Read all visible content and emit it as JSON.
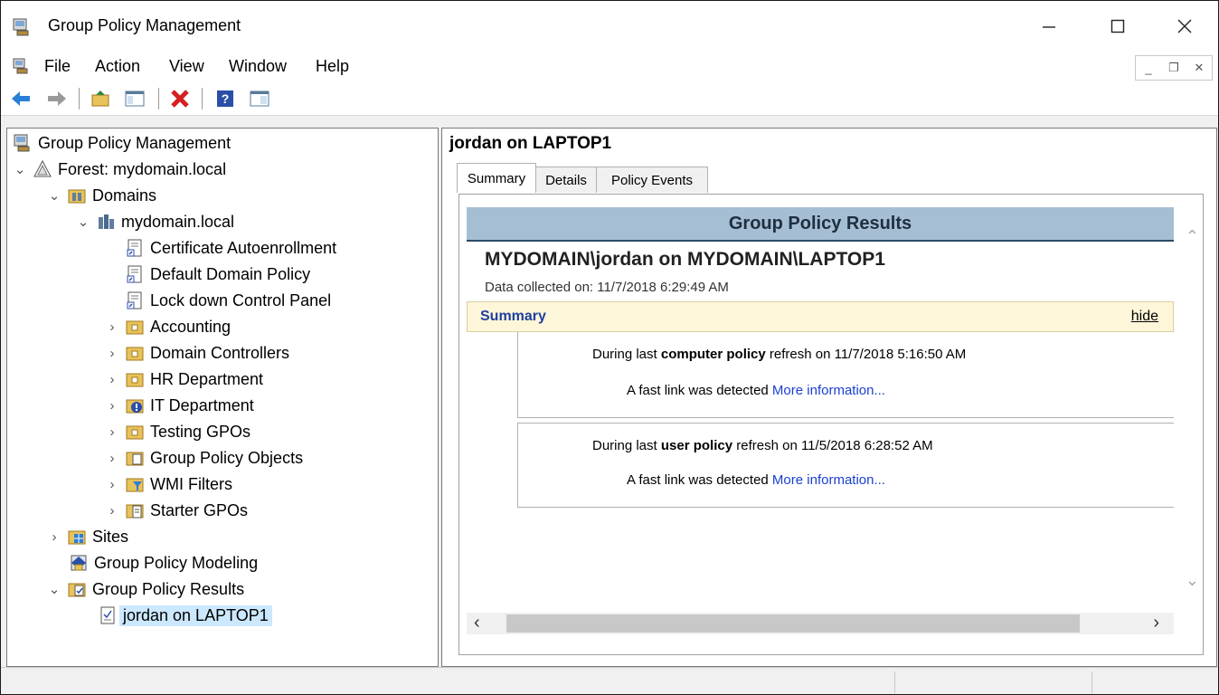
{
  "window": {
    "title": "Group Policy Management"
  },
  "menu": {
    "items": [
      "File",
      "Action",
      "View",
      "Window",
      "Help"
    ]
  },
  "toolbar": {
    "icons": [
      "back-arrow-icon",
      "forward-arrow-icon",
      "up-folder-icon",
      "show-hide-tree-icon",
      "delete-icon",
      "help-icon",
      "properties-icon"
    ]
  },
  "tree": {
    "items": [
      {
        "label": "Group Policy Management",
        "icon": "gpm-console-icon"
      },
      {
        "label": "Forest: mydomain.local",
        "icon": "forest-icon"
      },
      {
        "label": "Domains",
        "icon": "domains-icon"
      },
      {
        "label": "mydomain.local",
        "icon": "domain-icon"
      },
      {
        "label": "Certificate Autoenrollment",
        "icon": "gpo-link-icon"
      },
      {
        "label": "Default Domain Policy",
        "icon": "gpo-link-icon"
      },
      {
        "label": "Lock down Control Panel",
        "icon": "gpo-link-icon"
      },
      {
        "label": "Accounting",
        "icon": "ou-folder-icon"
      },
      {
        "label": "Domain Controllers",
        "icon": "ou-folder-icon"
      },
      {
        "label": "HR Department",
        "icon": "ou-folder-icon"
      },
      {
        "label": "IT Department",
        "icon": "ou-folder-blocked-icon"
      },
      {
        "label": "Testing GPOs",
        "icon": "ou-folder-icon"
      },
      {
        "label": "Group Policy Objects",
        "icon": "gpo-container-icon"
      },
      {
        "label": "WMI Filters",
        "icon": "wmi-filter-icon"
      },
      {
        "label": "Starter GPOs",
        "icon": "starter-gpo-icon"
      },
      {
        "label": "Sites",
        "icon": "sites-icon"
      },
      {
        "label": "Group Policy Modeling",
        "icon": "modeling-icon"
      },
      {
        "label": "Group Policy Results",
        "icon": "results-icon"
      },
      {
        "label": "jordan on LAPTOP1",
        "icon": "result-item-icon"
      }
    ]
  },
  "right": {
    "title": "jordan on LAPTOP1",
    "tabs": [
      "Summary",
      "Details",
      "Policy Events"
    ],
    "report": {
      "header": "Group Policy Results",
      "subject": "MYDOMAIN\\jordan on MYDOMAIN\\LAPTOP1",
      "collected": "Data collected on: 11/7/2018 6:29:49 AM",
      "section": "Summary",
      "hide": "hide",
      "computer": {
        "pre": "During last ",
        "bold": "computer policy",
        "post": " refresh on 11/7/2018 5:16:50 AM",
        "fast": "A fast link was detected ",
        "link": "More information..."
      },
      "user": {
        "pre": "During last ",
        "bold": "user policy",
        "post": " refresh on 11/5/2018 6:28:52 AM",
        "fast": "A fast link was detected ",
        "link": "More information..."
      }
    }
  }
}
